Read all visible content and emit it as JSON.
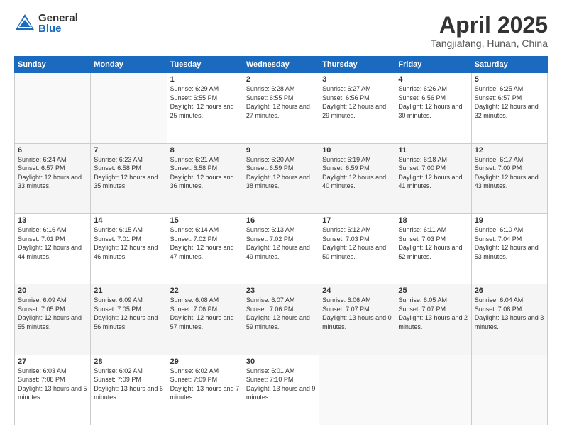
{
  "header": {
    "logo_general": "General",
    "logo_blue": "Blue",
    "title": "April 2025",
    "subtitle": "Tangjiafang, Hunan, China"
  },
  "days_of_week": [
    "Sunday",
    "Monday",
    "Tuesday",
    "Wednesday",
    "Thursday",
    "Friday",
    "Saturday"
  ],
  "weeks": [
    [
      {
        "day": "",
        "info": ""
      },
      {
        "day": "",
        "info": ""
      },
      {
        "day": "1",
        "info": "Sunrise: 6:29 AM\nSunset: 6:55 PM\nDaylight: 12 hours and 25 minutes."
      },
      {
        "day": "2",
        "info": "Sunrise: 6:28 AM\nSunset: 6:55 PM\nDaylight: 12 hours and 27 minutes."
      },
      {
        "day": "3",
        "info": "Sunrise: 6:27 AM\nSunset: 6:56 PM\nDaylight: 12 hours and 29 minutes."
      },
      {
        "day": "4",
        "info": "Sunrise: 6:26 AM\nSunset: 6:56 PM\nDaylight: 12 hours and 30 minutes."
      },
      {
        "day": "5",
        "info": "Sunrise: 6:25 AM\nSunset: 6:57 PM\nDaylight: 12 hours and 32 minutes."
      }
    ],
    [
      {
        "day": "6",
        "info": "Sunrise: 6:24 AM\nSunset: 6:57 PM\nDaylight: 12 hours and 33 minutes."
      },
      {
        "day": "7",
        "info": "Sunrise: 6:23 AM\nSunset: 6:58 PM\nDaylight: 12 hours and 35 minutes."
      },
      {
        "day": "8",
        "info": "Sunrise: 6:21 AM\nSunset: 6:58 PM\nDaylight: 12 hours and 36 minutes."
      },
      {
        "day": "9",
        "info": "Sunrise: 6:20 AM\nSunset: 6:59 PM\nDaylight: 12 hours and 38 minutes."
      },
      {
        "day": "10",
        "info": "Sunrise: 6:19 AM\nSunset: 6:59 PM\nDaylight: 12 hours and 40 minutes."
      },
      {
        "day": "11",
        "info": "Sunrise: 6:18 AM\nSunset: 7:00 PM\nDaylight: 12 hours and 41 minutes."
      },
      {
        "day": "12",
        "info": "Sunrise: 6:17 AM\nSunset: 7:00 PM\nDaylight: 12 hours and 43 minutes."
      }
    ],
    [
      {
        "day": "13",
        "info": "Sunrise: 6:16 AM\nSunset: 7:01 PM\nDaylight: 12 hours and 44 minutes."
      },
      {
        "day": "14",
        "info": "Sunrise: 6:15 AM\nSunset: 7:01 PM\nDaylight: 12 hours and 46 minutes."
      },
      {
        "day": "15",
        "info": "Sunrise: 6:14 AM\nSunset: 7:02 PM\nDaylight: 12 hours and 47 minutes."
      },
      {
        "day": "16",
        "info": "Sunrise: 6:13 AM\nSunset: 7:02 PM\nDaylight: 12 hours and 49 minutes."
      },
      {
        "day": "17",
        "info": "Sunrise: 6:12 AM\nSunset: 7:03 PM\nDaylight: 12 hours and 50 minutes."
      },
      {
        "day": "18",
        "info": "Sunrise: 6:11 AM\nSunset: 7:03 PM\nDaylight: 12 hours and 52 minutes."
      },
      {
        "day": "19",
        "info": "Sunrise: 6:10 AM\nSunset: 7:04 PM\nDaylight: 12 hours and 53 minutes."
      }
    ],
    [
      {
        "day": "20",
        "info": "Sunrise: 6:09 AM\nSunset: 7:05 PM\nDaylight: 12 hours and 55 minutes."
      },
      {
        "day": "21",
        "info": "Sunrise: 6:09 AM\nSunset: 7:05 PM\nDaylight: 12 hours and 56 minutes."
      },
      {
        "day": "22",
        "info": "Sunrise: 6:08 AM\nSunset: 7:06 PM\nDaylight: 12 hours and 57 minutes."
      },
      {
        "day": "23",
        "info": "Sunrise: 6:07 AM\nSunset: 7:06 PM\nDaylight: 12 hours and 59 minutes."
      },
      {
        "day": "24",
        "info": "Sunrise: 6:06 AM\nSunset: 7:07 PM\nDaylight: 13 hours and 0 minutes."
      },
      {
        "day": "25",
        "info": "Sunrise: 6:05 AM\nSunset: 7:07 PM\nDaylight: 13 hours and 2 minutes."
      },
      {
        "day": "26",
        "info": "Sunrise: 6:04 AM\nSunset: 7:08 PM\nDaylight: 13 hours and 3 minutes."
      }
    ],
    [
      {
        "day": "27",
        "info": "Sunrise: 6:03 AM\nSunset: 7:08 PM\nDaylight: 13 hours and 5 minutes."
      },
      {
        "day": "28",
        "info": "Sunrise: 6:02 AM\nSunset: 7:09 PM\nDaylight: 13 hours and 6 minutes."
      },
      {
        "day": "29",
        "info": "Sunrise: 6:02 AM\nSunset: 7:09 PM\nDaylight: 13 hours and 7 minutes."
      },
      {
        "day": "30",
        "info": "Sunrise: 6:01 AM\nSunset: 7:10 PM\nDaylight: 13 hours and 9 minutes."
      },
      {
        "day": "",
        "info": ""
      },
      {
        "day": "",
        "info": ""
      },
      {
        "day": "",
        "info": ""
      }
    ]
  ]
}
